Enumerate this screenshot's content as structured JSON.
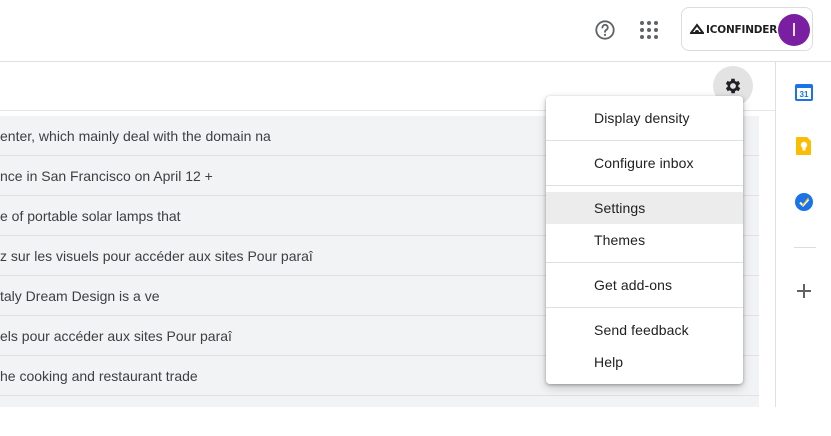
{
  "header": {
    "help_icon": "help-circle-icon",
    "apps_icon": "apps-grid-icon",
    "account": {
      "brand": "ICONFINDER",
      "avatar_letter": "I",
      "avatar_color": "#7b1fa2"
    }
  },
  "toolbar": {
    "settings_icon": "gear-icon"
  },
  "mail_rows": [
    "enter, which mainly deal with the domain na",
    "nce in San Francisco on April 12 +",
    "e of portable solar lamps that",
    "z sur les visuels pour accéder aux sites Pour paraî",
    "taly Dream Design is a ve",
    "els pour accéder aux sites Pour paraî",
    "he cooking and restaurant trade"
  ],
  "settings_menu": {
    "items": [
      "Display density",
      "Configure inbox",
      "Settings",
      "Themes",
      "Get add-ons",
      "Send feedback",
      "Help"
    ],
    "highlighted": "Settings"
  },
  "side_panel": {
    "calendar": {
      "icon": "calendar-icon",
      "day": "31",
      "color": "#1a73e8"
    },
    "keep": {
      "icon": "keep-bulb-icon",
      "color": "#fbbc04"
    },
    "tasks": {
      "icon": "tasks-check-icon",
      "color": "#1a73e8"
    },
    "add": {
      "icon": "plus-icon"
    }
  }
}
